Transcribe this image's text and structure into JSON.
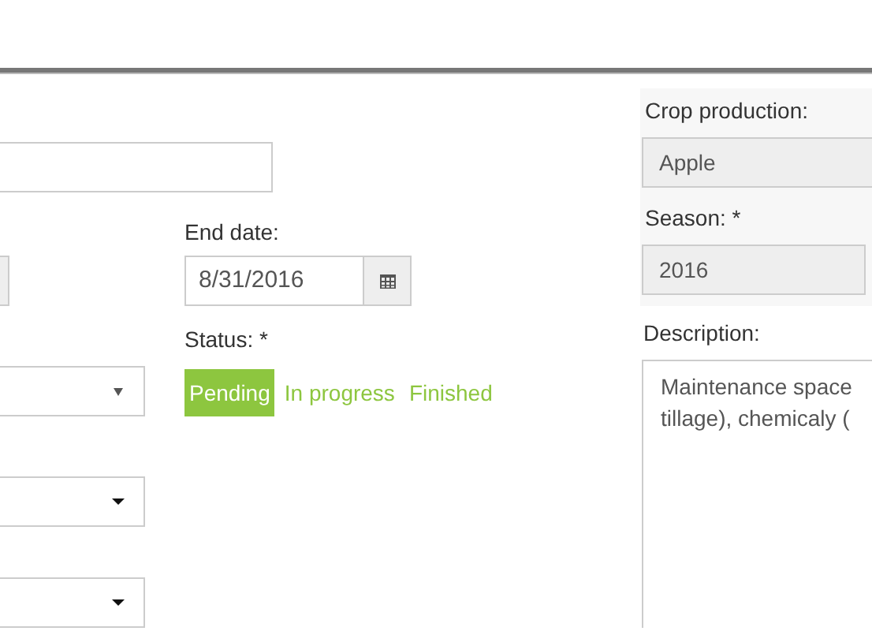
{
  "left_column": {
    "selects": [
      {
        "kind": "native"
      },
      {
        "kind": "custom"
      },
      {
        "kind": "custom"
      }
    ]
  },
  "end_date": {
    "label": "End date:",
    "value": "8/31/2016"
  },
  "status": {
    "label": "Status: *",
    "options": [
      {
        "label": "Pending",
        "selected": true
      },
      {
        "label": "In progress",
        "selected": false
      },
      {
        "label": "Finished",
        "selected": false
      }
    ]
  },
  "crop_production": {
    "label": "Crop production:",
    "value": "Apple"
  },
  "season": {
    "label": "Season: *",
    "value": "2016"
  },
  "description": {
    "label": "Description:",
    "value": "Maintenance space\ntillage), chemicaly ("
  }
}
